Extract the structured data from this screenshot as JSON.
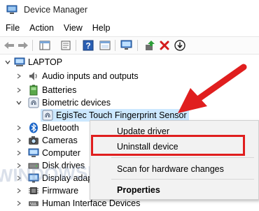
{
  "window": {
    "title": "Device Manager"
  },
  "menubar": {
    "items": [
      "File",
      "Action",
      "View",
      "Help"
    ]
  },
  "toolbar": {
    "buttons": [
      "back-arrow-icon",
      "forward-arrow-icon",
      "properties-icon",
      "help-icon",
      "scan-monitor-icon",
      "update-driver-icon",
      "uninstall-x-icon",
      "download-icon"
    ]
  },
  "tree": {
    "root": "LAPTOP",
    "items": [
      {
        "label": "Audio inputs and outputs",
        "icon": "speaker-icon"
      },
      {
        "label": "Batteries",
        "icon": "battery-icon"
      },
      {
        "label": "Biometric devices",
        "icon": "fingerprint-icon"
      },
      {
        "label": "EgisTec Touch Fingerprint Sensor",
        "icon": "fingerprint-icon"
      },
      {
        "label": "Bluetooth",
        "icon": "bluetooth-icon"
      },
      {
        "label": "Cameras",
        "icon": "camera-icon"
      },
      {
        "label": "Computer",
        "icon": "computer-icon"
      },
      {
        "label": "Disk drives",
        "icon": "disk-icon"
      },
      {
        "label": "Display adap",
        "icon": "display-icon"
      },
      {
        "label": "Firmware",
        "icon": "chip-icon"
      },
      {
        "label": "Human Interface Devices",
        "icon": "hid-icon"
      }
    ]
  },
  "context_menu": {
    "update": "Update driver",
    "uninstall": "Uninstall device",
    "scan": "Scan for hardware changes",
    "properties": "Properties"
  },
  "watermark": "WINDOWSDIGITAL.COM",
  "colors": {
    "annotation_red": "#e01e1e",
    "selection_blue": "#cce8ff"
  }
}
